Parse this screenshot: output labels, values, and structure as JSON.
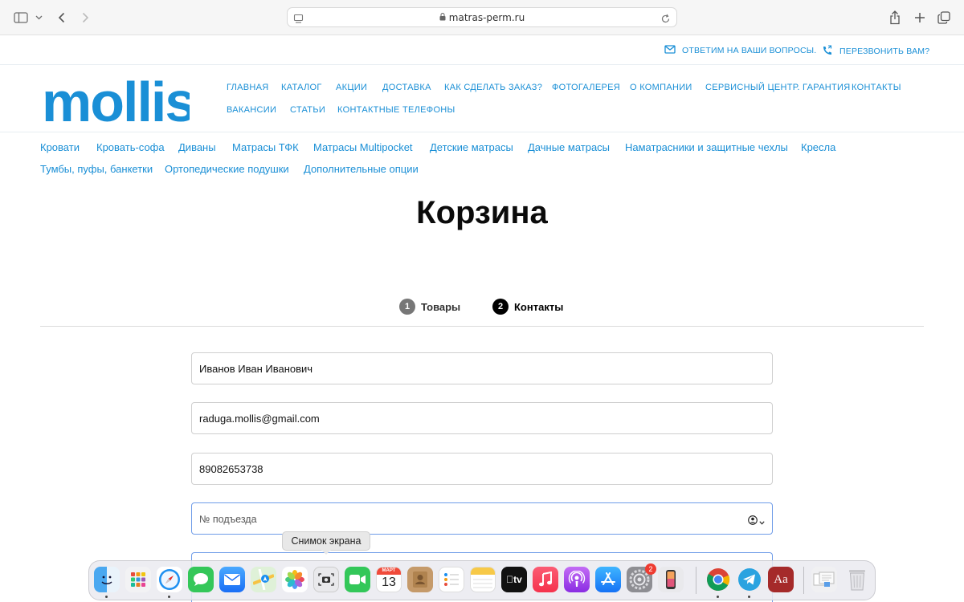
{
  "browser": {
    "url": "matras-perm.ru",
    "icons": [
      "sidebar-icon",
      "chevron-down-icon",
      "back-icon",
      "forward-icon",
      "page-menu-icon",
      "lock-icon",
      "reload-icon",
      "share-icon",
      "new-tab-icon",
      "tabs-overview-icon"
    ]
  },
  "top_links": {
    "questions": "ОТВЕТИМ НА ВАШИ ВОПРОСЫ.",
    "callback": "ПЕРЕЗВОНИТЬ ВАМ?"
  },
  "logo": {
    "text": "mollis",
    "color": "#1a8fd6"
  },
  "main_nav": [
    "ГЛАВНАЯ",
    "КАТАЛОГ",
    "АКЦИИ",
    "ДОСТАВКА",
    "КАК СДЕЛАТЬ ЗАКАЗ?",
    "ФОТОГАЛЕРЕЯ",
    "О КОМПАНИИ",
    "СЕРВИСНЫЙ ЦЕНТР. ГАРАНТИЯ",
    "КОНТАКТЫ",
    "ВАКАНСИИ",
    "СТАТЬИ",
    "КОНТАКТНЫЕ ТЕЛЕФОНЫ"
  ],
  "category_nav": [
    "Кровати",
    "Кровать-софа",
    "Диваны",
    "Матрасы ТФК",
    "Матрасы Multipocket",
    "Детские матрасы",
    "Дачные матрасы",
    "Наматрасники и защитные чехлы",
    "Кресла",
    "Тумбы, пуфы, банкетки",
    "Ортопедические подушки",
    "Дополнительные опции"
  ],
  "page_title": "Корзина",
  "steps": [
    {
      "num": "1",
      "label": "Товары",
      "active": false
    },
    {
      "num": "2",
      "label": "Контакты",
      "active": true
    }
  ],
  "form": {
    "name": "Иванов Иван Иванович",
    "email": "raduga.mollis@gmail.com",
    "phone": "89082653738",
    "entrance_placeholder": "№ подъезда"
  },
  "tooltip": "Снимок экрана",
  "dock": {
    "apps": [
      "Finder",
      "Launchpad",
      "Safari",
      "Messages",
      "Mail",
      "Maps",
      "Photos",
      "Screenshot",
      "FaceTime",
      "Calendar",
      "Contacts",
      "Reminders",
      "Notes",
      "TV",
      "Music",
      "Podcasts",
      "App Store",
      "System Settings",
      "iPhone Mirroring",
      "Chrome",
      "Telegram",
      "Dictionary",
      "Preview",
      "Trash"
    ],
    "calendar_month": "МАРТ",
    "calendar_day": "13",
    "settings_badge": "2",
    "tv_label": "tv",
    "dictionary_label": "Aa"
  },
  "colors": {
    "accent": "#1a8fd6",
    "focus": "#6f9ce8"
  }
}
